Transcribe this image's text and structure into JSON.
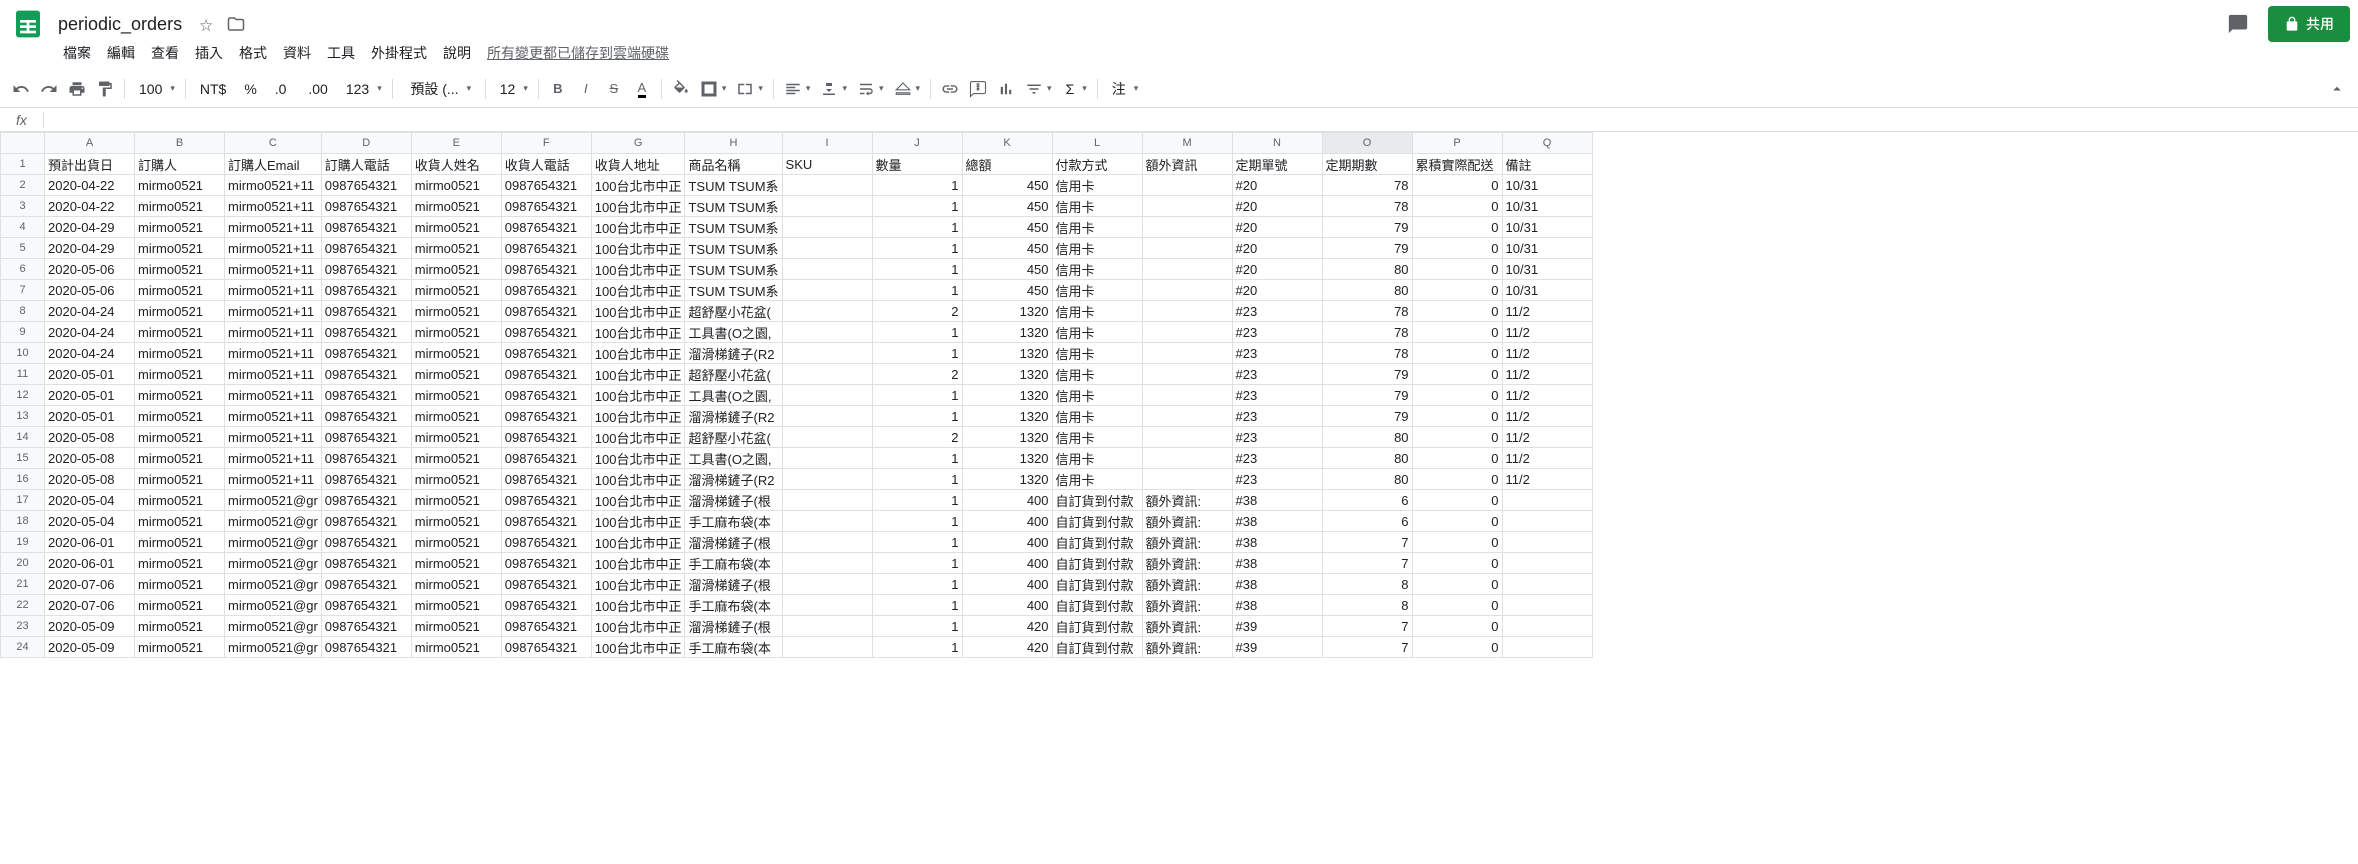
{
  "doc": {
    "name": "periodic_orders"
  },
  "share_label": "共用",
  "menu": {
    "items": [
      "檔案",
      "編輯",
      "查看",
      "插入",
      "格式",
      "資料",
      "工具",
      "外掛程式",
      "說明"
    ],
    "save_status": "所有變更都已儲存到雲端硬碟"
  },
  "toolbar": {
    "zoom": "100",
    "currency": "NT$",
    "num_btn": "123",
    "font": "預設 (...",
    "font_size": "12",
    "notes": "注"
  },
  "fx": {
    "label": "fx"
  },
  "columns": [
    "A",
    "B",
    "C",
    "D",
    "E",
    "F",
    "G",
    "H",
    "I",
    "J",
    "K",
    "L",
    "M",
    "N",
    "O",
    "P",
    "Q"
  ],
  "headers": [
    "預計出貨日",
    "訂購人",
    "訂購人Email",
    "訂購人電話",
    "收貨人姓名",
    "收貨人電話",
    "收貨人地址",
    "商品名稱",
    "SKU",
    "數量",
    "總額",
    "付款方式",
    "額外資訊",
    "定期單號",
    "定期期數",
    "累積實際配送",
    "備註"
  ],
  "selected_col": 14,
  "rows": [
    [
      "2020-04-22",
      "mirmo0521",
      "mirmo0521+11",
      "0987654321",
      "mirmo0521",
      "0987654321",
      "100台北市中正",
      "TSUM TSUM系",
      "",
      "1",
      "450",
      "信用卡",
      "",
      "#20",
      "78",
      "0",
      "10/31"
    ],
    [
      "2020-04-22",
      "mirmo0521",
      "mirmo0521+11",
      "0987654321",
      "mirmo0521",
      "0987654321",
      "100台北市中正",
      "TSUM TSUM系",
      "",
      "1",
      "450",
      "信用卡",
      "",
      "#20",
      "78",
      "0",
      "10/31"
    ],
    [
      "2020-04-29",
      "mirmo0521",
      "mirmo0521+11",
      "0987654321",
      "mirmo0521",
      "0987654321",
      "100台北市中正",
      "TSUM TSUM系",
      "",
      "1",
      "450",
      "信用卡",
      "",
      "#20",
      "79",
      "0",
      "10/31"
    ],
    [
      "2020-04-29",
      "mirmo0521",
      "mirmo0521+11",
      "0987654321",
      "mirmo0521",
      "0987654321",
      "100台北市中正",
      "TSUM TSUM系",
      "",
      "1",
      "450",
      "信用卡",
      "",
      "#20",
      "79",
      "0",
      "10/31"
    ],
    [
      "2020-05-06",
      "mirmo0521",
      "mirmo0521+11",
      "0987654321",
      "mirmo0521",
      "0987654321",
      "100台北市中正",
      "TSUM TSUM系",
      "",
      "1",
      "450",
      "信用卡",
      "",
      "#20",
      "80",
      "0",
      "10/31"
    ],
    [
      "2020-05-06",
      "mirmo0521",
      "mirmo0521+11",
      "0987654321",
      "mirmo0521",
      "0987654321",
      "100台北市中正",
      "TSUM TSUM系",
      "",
      "1",
      "450",
      "信用卡",
      "",
      "#20",
      "80",
      "0",
      "10/31"
    ],
    [
      "2020-04-24",
      "mirmo0521",
      "mirmo0521+11",
      "0987654321",
      "mirmo0521",
      "0987654321",
      "100台北市中正",
      "超舒壓小花盆(",
      "",
      "2",
      "1320",
      "信用卡",
      "",
      "#23",
      "78",
      "0",
      "11/2"
    ],
    [
      "2020-04-24",
      "mirmo0521",
      "mirmo0521+11",
      "0987654321",
      "mirmo0521",
      "0987654321",
      "100台北市中正",
      "工具書(O之園,",
      "",
      "1",
      "1320",
      "信用卡",
      "",
      "#23",
      "78",
      "0",
      "11/2"
    ],
    [
      "2020-04-24",
      "mirmo0521",
      "mirmo0521+11",
      "0987654321",
      "mirmo0521",
      "0987654321",
      "100台北市中正",
      "溜滑梯鏟子(R2",
      "",
      "1",
      "1320",
      "信用卡",
      "",
      "#23",
      "78",
      "0",
      "11/2"
    ],
    [
      "2020-05-01",
      "mirmo0521",
      "mirmo0521+11",
      "0987654321",
      "mirmo0521",
      "0987654321",
      "100台北市中正",
      "超舒壓小花盆(",
      "",
      "2",
      "1320",
      "信用卡",
      "",
      "#23",
      "79",
      "0",
      "11/2"
    ],
    [
      "2020-05-01",
      "mirmo0521",
      "mirmo0521+11",
      "0987654321",
      "mirmo0521",
      "0987654321",
      "100台北市中正",
      "工具書(O之園,",
      "",
      "1",
      "1320",
      "信用卡",
      "",
      "#23",
      "79",
      "0",
      "11/2"
    ],
    [
      "2020-05-01",
      "mirmo0521",
      "mirmo0521+11",
      "0987654321",
      "mirmo0521",
      "0987654321",
      "100台北市中正",
      "溜滑梯鏟子(R2",
      "",
      "1",
      "1320",
      "信用卡",
      "",
      "#23",
      "79",
      "0",
      "11/2"
    ],
    [
      "2020-05-08",
      "mirmo0521",
      "mirmo0521+11",
      "0987654321",
      "mirmo0521",
      "0987654321",
      "100台北市中正",
      "超舒壓小花盆(",
      "",
      "2",
      "1320",
      "信用卡",
      "",
      "#23",
      "80",
      "0",
      "11/2"
    ],
    [
      "2020-05-08",
      "mirmo0521",
      "mirmo0521+11",
      "0987654321",
      "mirmo0521",
      "0987654321",
      "100台北市中正",
      "工具書(O之園,",
      "",
      "1",
      "1320",
      "信用卡",
      "",
      "#23",
      "80",
      "0",
      "11/2"
    ],
    [
      "2020-05-08",
      "mirmo0521",
      "mirmo0521+11",
      "0987654321",
      "mirmo0521",
      "0987654321",
      "100台北市中正",
      "溜滑梯鏟子(R2",
      "",
      "1",
      "1320",
      "信用卡",
      "",
      "#23",
      "80",
      "0",
      "11/2"
    ],
    [
      "2020-05-04",
      "mirmo0521",
      "mirmo0521@gr",
      "0987654321",
      "mirmo0521",
      "0987654321",
      "100台北市中正",
      "溜滑梯鏟子(根",
      "",
      "1",
      "400",
      "自訂貨到付款",
      "額外資訊:",
      "#38",
      "6",
      "0",
      ""
    ],
    [
      "2020-05-04",
      "mirmo0521",
      "mirmo0521@gr",
      "0987654321",
      "mirmo0521",
      "0987654321",
      "100台北市中正",
      "手工麻布袋(本",
      "",
      "1",
      "400",
      "自訂貨到付款",
      "額外資訊:",
      "#38",
      "6",
      "0",
      ""
    ],
    [
      "2020-06-01",
      "mirmo0521",
      "mirmo0521@gr",
      "0987654321",
      "mirmo0521",
      "0987654321",
      "100台北市中正",
      "溜滑梯鏟子(根",
      "",
      "1",
      "400",
      "自訂貨到付款",
      "額外資訊:",
      "#38",
      "7",
      "0",
      ""
    ],
    [
      "2020-06-01",
      "mirmo0521",
      "mirmo0521@gr",
      "0987654321",
      "mirmo0521",
      "0987654321",
      "100台北市中正",
      "手工麻布袋(本",
      "",
      "1",
      "400",
      "自訂貨到付款",
      "額外資訊:",
      "#38",
      "7",
      "0",
      ""
    ],
    [
      "2020-07-06",
      "mirmo0521",
      "mirmo0521@gr",
      "0987654321",
      "mirmo0521",
      "0987654321",
      "100台北市中正",
      "溜滑梯鏟子(根",
      "",
      "1",
      "400",
      "自訂貨到付款",
      "額外資訊:",
      "#38",
      "8",
      "0",
      ""
    ],
    [
      "2020-07-06",
      "mirmo0521",
      "mirmo0521@gr",
      "0987654321",
      "mirmo0521",
      "0987654321",
      "100台北市中正",
      "手工麻布袋(本",
      "",
      "1",
      "400",
      "自訂貨到付款",
      "額外資訊:",
      "#38",
      "8",
      "0",
      ""
    ],
    [
      "2020-05-09",
      "mirmo0521",
      "mirmo0521@gr",
      "0987654321",
      "mirmo0521",
      "0987654321",
      "100台北市中正",
      "溜滑梯鏟子(根",
      "",
      "1",
      "420",
      "自訂貨到付款",
      "額外資訊:",
      "#39",
      "7",
      "0",
      ""
    ],
    [
      "2020-05-09",
      "mirmo0521",
      "mirmo0521@gr",
      "0987654321",
      "mirmo0521",
      "0987654321",
      "100台北市中正",
      "手工麻布袋(本",
      "",
      "1",
      "420",
      "自訂貨到付款",
      "額外資訊:",
      "#39",
      "7",
      "0",
      ""
    ]
  ],
  "numeric_cols": [
    9,
    10,
    14,
    15
  ]
}
